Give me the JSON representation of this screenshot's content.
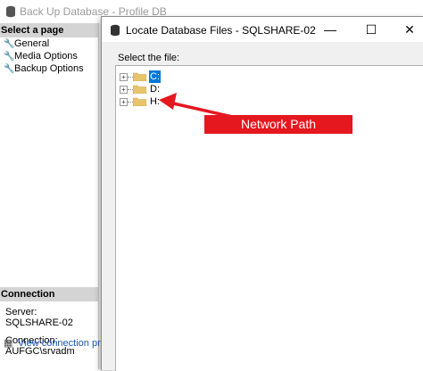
{
  "background_window": {
    "title": "Back Up Database - Profile DB",
    "select_page_header": "Select a page",
    "pages": [
      {
        "label": "General"
      },
      {
        "label": "Media Options"
      },
      {
        "label": "Backup Options"
      }
    ],
    "connection_header": "Connection",
    "server_label": "Server:",
    "server_value": "SQLSHARE-02",
    "connection_label": "Connection:",
    "connection_value": "AUFGC\\srvadm",
    "view_link": "View connection prope"
  },
  "dialog": {
    "title": "Locate Database Files - SQLSHARE-02",
    "minimize_glyph": "—",
    "maximize_glyph": "☐",
    "close_glyph": "✕",
    "select_label": "Select the file:",
    "drives": [
      {
        "label": "C:",
        "selected": true
      },
      {
        "label": "D:",
        "selected": false
      },
      {
        "label": "H:",
        "selected": false
      }
    ]
  },
  "annotation": {
    "text": "Network Path",
    "color": "#e5171f"
  },
  "colors": {
    "selection": "#0078d7",
    "link": "#1a58c5",
    "folder": "#e8c46b"
  }
}
